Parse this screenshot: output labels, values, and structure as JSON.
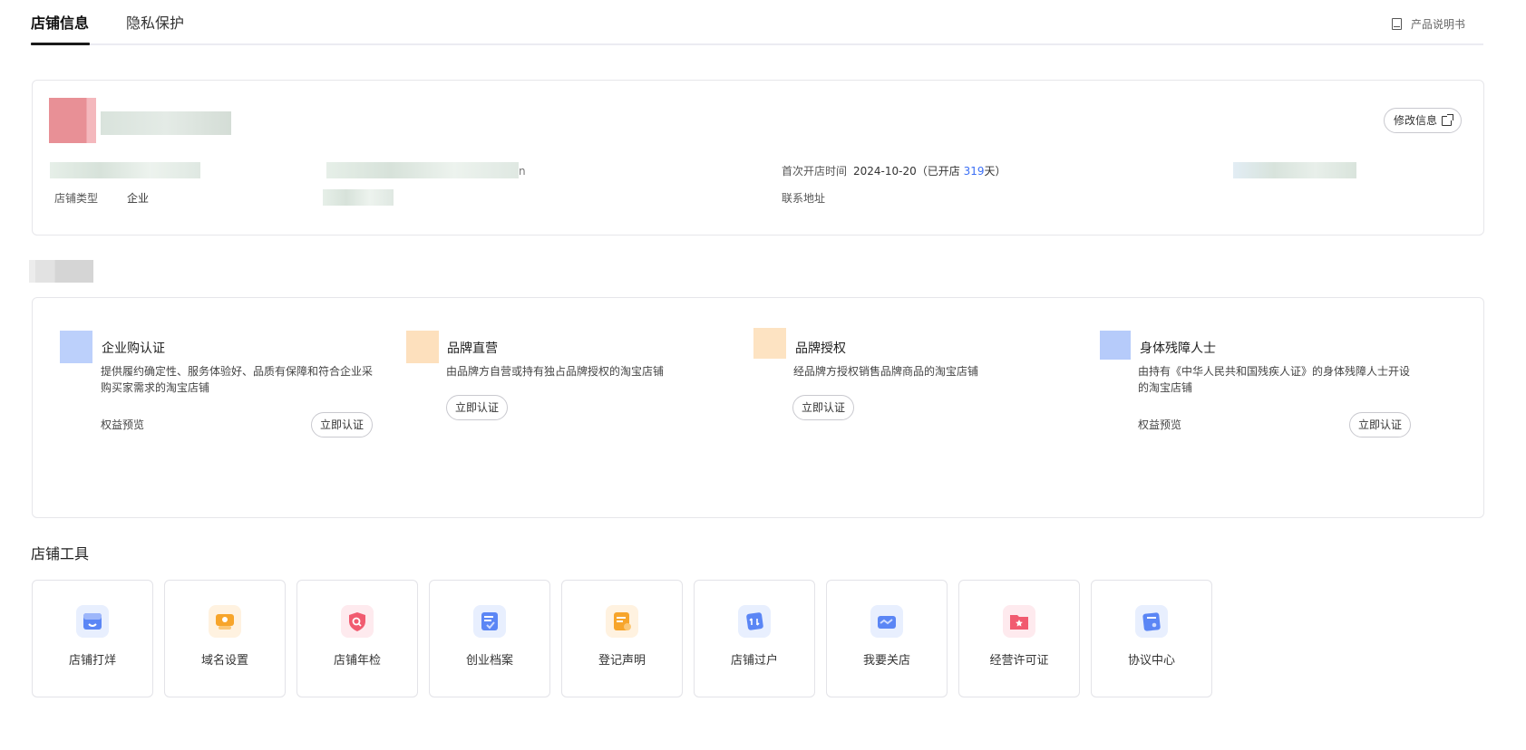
{
  "tabs": [
    {
      "label": "店铺信息",
      "active": true
    },
    {
      "label": "隐私保护",
      "active": false
    }
  ],
  "header": {
    "manual_label": "产品说明书",
    "manual_icon": "book-icon"
  },
  "shop": {
    "edit_label": "修改信息",
    "first_open_label": "首次开店时间",
    "first_open_date": "2024-10-20",
    "open_prefix": "（已开店 ",
    "open_days": "319",
    "open_suffix": "天）",
    "shop_type_label": "店铺类型",
    "shop_type_value": "企业",
    "contact_address_label": "联系地址",
    "trailing_glyph": "n"
  },
  "certs": [
    {
      "title": "企业购认证",
      "desc": "提供履约确定性、服务体验好、品质有保障和符合企业采购买家需求的淘宝店铺",
      "benefit": "权益预览",
      "button": "立即认证",
      "icon_color": "#bcd0fb"
    },
    {
      "title": "品牌直营",
      "desc": "由品牌方自营或持有独占品牌授权的淘宝店铺",
      "button": "立即认证",
      "icon_color": "#fde0bd"
    },
    {
      "title": "品牌授权",
      "desc": "经品牌方授权销售品牌商品的淘宝店铺",
      "button": "立即认证",
      "icon_color": "#fde3c2"
    },
    {
      "title": "身体残障人士",
      "desc": "由持有《中华人民共和国残疾人证》的身体残障人士开设的淘宝店铺",
      "benefit": "权益预览",
      "button": "立即认证",
      "icon_color": "#b6cbfa"
    }
  ],
  "tools": {
    "title": "店铺工具",
    "items": [
      {
        "label": "店铺打烊",
        "icon": "shop-close-icon",
        "color": "#4d7cf3"
      },
      {
        "label": "域名设置",
        "icon": "domain-icon",
        "color": "#f5a025"
      },
      {
        "label": "店铺年检",
        "icon": "annual-check-icon",
        "color": "#f0566b"
      },
      {
        "label": "创业档案",
        "icon": "archive-icon",
        "color": "#4d7cf3"
      },
      {
        "label": "登记声明",
        "icon": "registration-icon",
        "color": "#f5a025"
      },
      {
        "label": "店铺过户",
        "icon": "transfer-icon",
        "color": "#4d7cf3"
      },
      {
        "label": "我要关店",
        "icon": "close-store-icon",
        "color": "#4d7cf3"
      },
      {
        "label": "经营许可证",
        "icon": "license-icon",
        "color": "#f0566b"
      },
      {
        "label": "协议中心",
        "icon": "agreement-icon",
        "color": "#4d7cf3"
      }
    ]
  }
}
